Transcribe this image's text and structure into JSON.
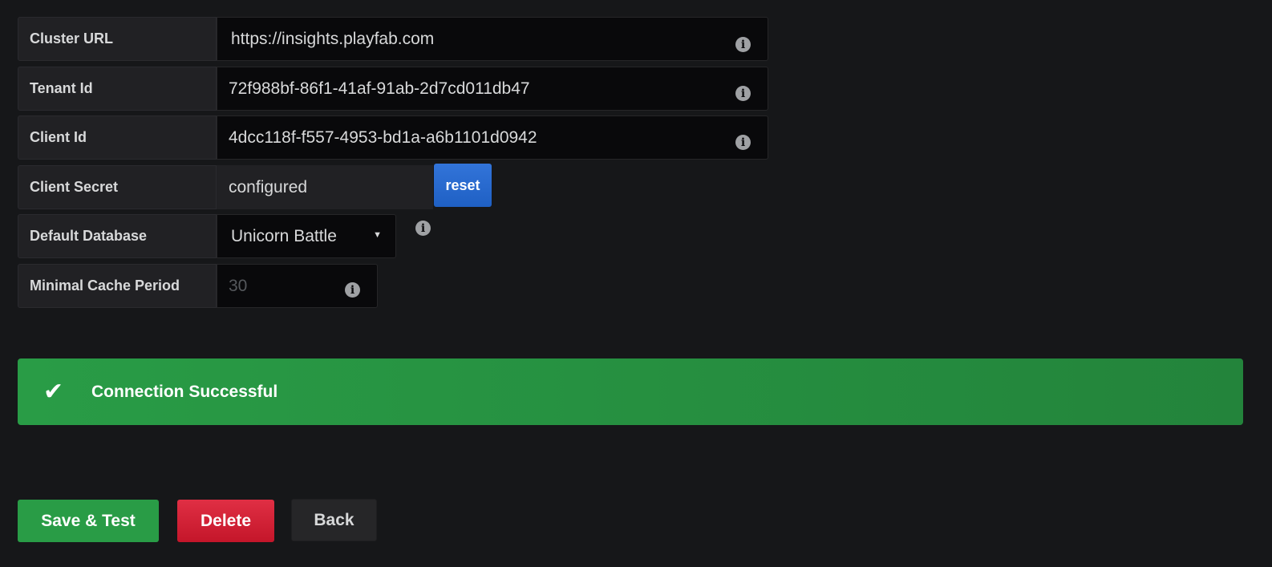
{
  "form": {
    "cluster_url": {
      "label": "Cluster URL",
      "value": "https://insights.playfab.com"
    },
    "tenant_id": {
      "label": "Tenant Id",
      "value": "72f988bf-86f1-41af-91ab-2d7cd011db47"
    },
    "client_id": {
      "label": "Client Id",
      "value": "4dcc118f-f557-4953-bd1a-a6b1101d0942"
    },
    "client_secret": {
      "label": "Client Secret",
      "value": "configured",
      "reset_label": "reset"
    },
    "default_database": {
      "label": "Default Database",
      "value": "Unicorn Battle"
    },
    "min_cache_period": {
      "label": "Minimal Cache Period",
      "placeholder": "30"
    }
  },
  "alert": {
    "text": "Connection Successful",
    "icon": "check-icon",
    "color": "#299c46"
  },
  "buttons": {
    "save_test": "Save & Test",
    "delete": "Delete",
    "back": "Back"
  },
  "icons": {
    "info": "i",
    "caret": "▼",
    "check": "✔"
  },
  "colors": {
    "primary": "#1f60c4",
    "success": "#299c46",
    "danger": "#d44a3a"
  }
}
